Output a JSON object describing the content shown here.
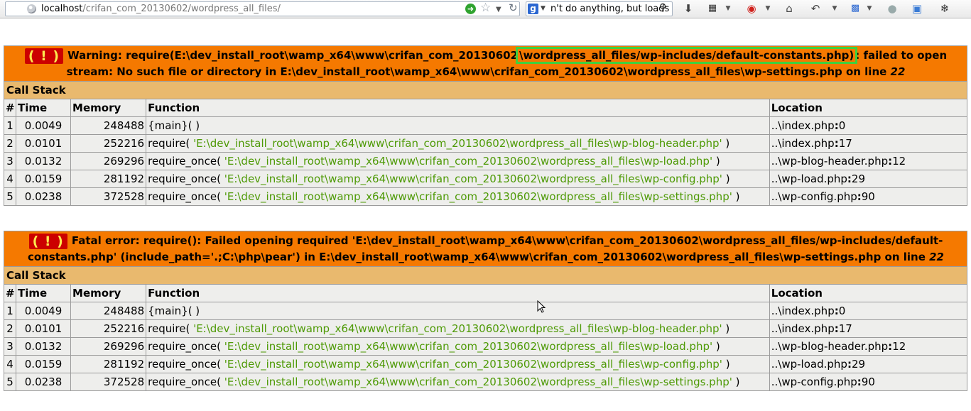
{
  "browser": {
    "url_host": "localhost",
    "url_path": "/crifan_com_20130602/wordpress_all_files/",
    "search_text": "n't do anything, but loads",
    "icons": [
      "globe-icon",
      "go-icon",
      "star-icon",
      "dropdown-icon",
      "refresh-icon",
      "google-icon",
      "search-icon",
      "download-icon",
      "tools-icon",
      "weibo-icon",
      "home-icon",
      "history-icon",
      "apps-icon",
      "sync-icon",
      "addon-icon",
      "bug-icon"
    ]
  },
  "errors": [
    {
      "badge": "( ! )",
      "message_prefix": "Warning: require(E:\\dev_install_root\\wamp_x64\\www\\crifan_com_20130602",
      "message_highlight": "\\wordpress_all_files/wp-includes/default-constants.php)",
      "message_suffix": ": failed to open stream: No such file or directory in E:\\dev_install_root\\wamp_x64\\www\\crifan_com_20130602\\wordpress_all_files\\wp-settings.php on line ",
      "line": "22",
      "call_stack_label": "Call Stack",
      "headers": {
        "num": "#",
        "time": "Time",
        "memory": "Memory",
        "function": "Function",
        "location": "Location"
      },
      "rows": [
        {
          "idx": "1",
          "time": "0.0049",
          "memory": "248488",
          "func": "{main}( )",
          "arg": "",
          "close": "",
          "file": "..\\index.php",
          "line": "0"
        },
        {
          "idx": "2",
          "time": "0.0101",
          "memory": "252216",
          "func": "require( ",
          "arg": "'E:\\dev_install_root\\wamp_x64\\www\\crifan_com_20130602\\wordpress_all_files\\wp-blog-header.php'",
          "close": " )",
          "file": "..\\index.php",
          "line": "17"
        },
        {
          "idx": "3",
          "time": "0.0132",
          "memory": "269296",
          "func": "require_once( ",
          "arg": "'E:\\dev_install_root\\wamp_x64\\www\\crifan_com_20130602\\wordpress_all_files\\wp-load.php'",
          "close": " )",
          "file": "..\\wp-blog-header.php",
          "line": "12"
        },
        {
          "idx": "4",
          "time": "0.0159",
          "memory": "281192",
          "func": "require_once( ",
          "arg": "'E:\\dev_install_root\\wamp_x64\\www\\crifan_com_20130602\\wordpress_all_files\\wp-config.php'",
          "close": " )",
          "file": "..\\wp-load.php",
          "line": "29"
        },
        {
          "idx": "5",
          "time": "0.0238",
          "memory": "372528",
          "func": "require_once( ",
          "arg": "'E:\\dev_install_root\\wamp_x64\\www\\crifan_com_20130602\\wordpress_all_files\\wp-settings.php'",
          "close": " )",
          "file": "..\\wp-config.php",
          "line": "90"
        }
      ]
    },
    {
      "badge": "( ! )",
      "message_prefix": "Fatal error: require(): Failed opening required 'E:\\dev_install_root\\wamp_x64\\www\\crifan_com_20130602\\wordpress_all_files/wp-includes/default-constants.php' (include_path='.;C:\\php\\pear') in E:\\dev_install_root\\wamp_x64\\www\\crifan_com_20130602\\wordpress_all_files\\wp-settings.php on line ",
      "message_highlight": "",
      "message_suffix": "",
      "line": "22",
      "call_stack_label": "Call Stack",
      "headers": {
        "num": "#",
        "time": "Time",
        "memory": "Memory",
        "function": "Function",
        "location": "Location"
      },
      "rows": [
        {
          "idx": "1",
          "time": "0.0049",
          "memory": "248488",
          "func": "{main}( )",
          "arg": "",
          "close": "",
          "file": "..\\index.php",
          "line": "0"
        },
        {
          "idx": "2",
          "time": "0.0101",
          "memory": "252216",
          "func": "require( ",
          "arg": "'E:\\dev_install_root\\wamp_x64\\www\\crifan_com_20130602\\wordpress_all_files\\wp-blog-header.php'",
          "close": " )",
          "file": "..\\index.php",
          "line": "17"
        },
        {
          "idx": "3",
          "time": "0.0132",
          "memory": "269296",
          "func": "require_once( ",
          "arg": "'E:\\dev_install_root\\wamp_x64\\www\\crifan_com_20130602\\wordpress_all_files\\wp-load.php'",
          "close": " )",
          "file": "..\\wp-blog-header.php",
          "line": "12"
        },
        {
          "idx": "4",
          "time": "0.0159",
          "memory": "281192",
          "func": "require_once( ",
          "arg": "'E:\\dev_install_root\\wamp_x64\\www\\crifan_com_20130602\\wordpress_all_files\\wp-config.php'",
          "close": " )",
          "file": "..\\wp-load.php",
          "line": "29"
        },
        {
          "idx": "5",
          "time": "0.0238",
          "memory": "372528",
          "func": "require_once( ",
          "arg": "'E:\\dev_install_root\\wamp_x64\\www\\crifan_com_20130602\\wordpress_all_files\\wp-settings.php'",
          "close": " )",
          "file": "..\\wp-config.php",
          "line": "90"
        }
      ]
    }
  ]
}
